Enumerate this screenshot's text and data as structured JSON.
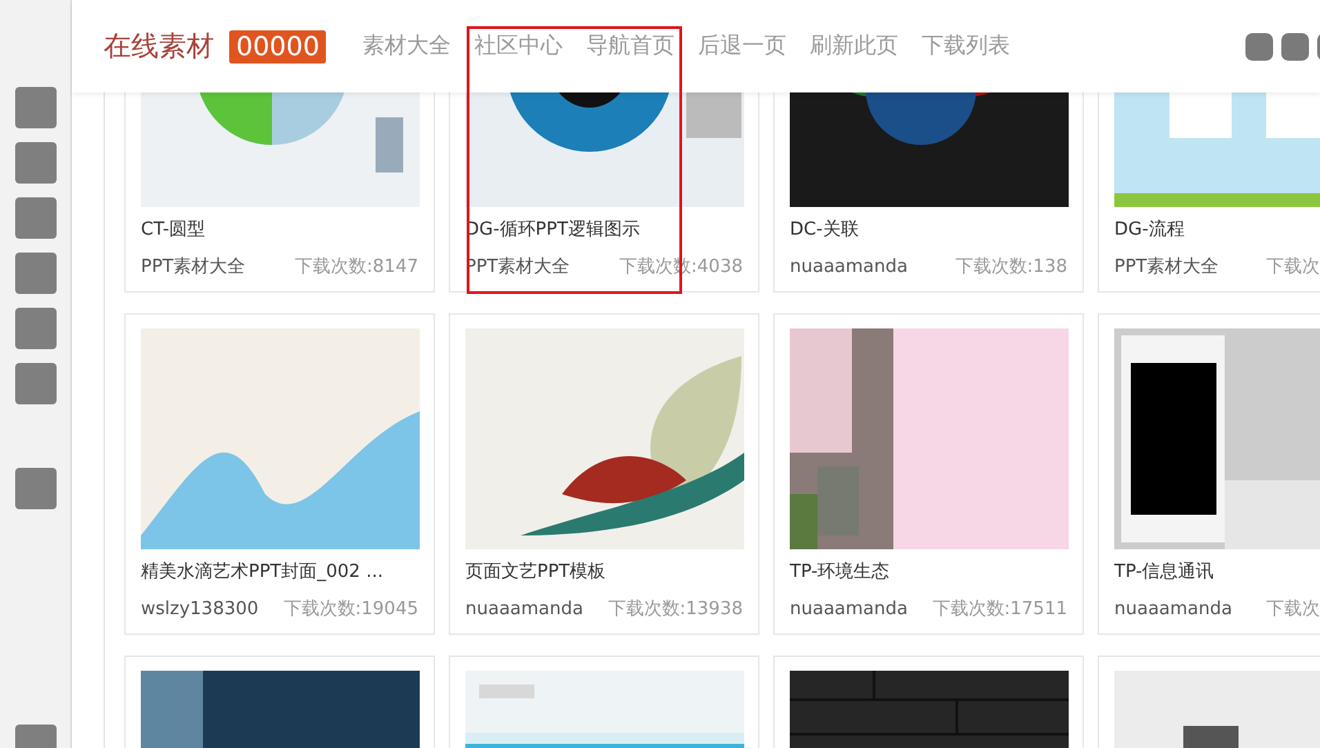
{
  "header": {
    "title": "在线素材",
    "badge": "00000",
    "nav": [
      "素材大全",
      "社区中心",
      "导航首页",
      "后退一页",
      "刷新此页",
      "下载列表"
    ]
  },
  "card_rows": [
    {
      "cards": [
        {
          "kind": "template",
          "title": "CT-圆型",
          "author": "PPT素材大全",
          "downloads": "下载次数:8147"
        },
        {
          "kind": "template",
          "title": "DG-循环PPT逻辑图示",
          "author": "PPT素材大全",
          "downloads": "下载次数:4038"
        },
        {
          "kind": "template",
          "title": "DC-关联",
          "author": "nuaaamanda",
          "downloads": "下载次数:138"
        },
        {
          "kind": "template",
          "title": "DG-流程",
          "author": "PPT素材大全",
          "downloads": "下载次"
        }
      ]
    },
    {
      "cards": [
        {
          "kind": "template",
          "title": "精美水滴艺术PPT封面_002 ...",
          "author": "wslzy138300",
          "downloads": "下载次数:19045"
        },
        {
          "kind": "template",
          "title": "页面文艺PPT模板",
          "author": "nuaaamanda",
          "downloads": "下载次数:13938"
        },
        {
          "kind": "template",
          "title": "TP-环境生态",
          "author": "nuaaamanda",
          "downloads": "下载次数:17511"
        },
        {
          "kind": "template",
          "title": "TP-信息通讯",
          "author": "nuaaamanda",
          "downloads": "下载次"
        }
      ]
    },
    {
      "cards": [
        {
          "kind": "picture"
        },
        {
          "kind": "picture"
        },
        {
          "kind": "picture"
        },
        {
          "kind": "picture"
        }
      ]
    }
  ]
}
